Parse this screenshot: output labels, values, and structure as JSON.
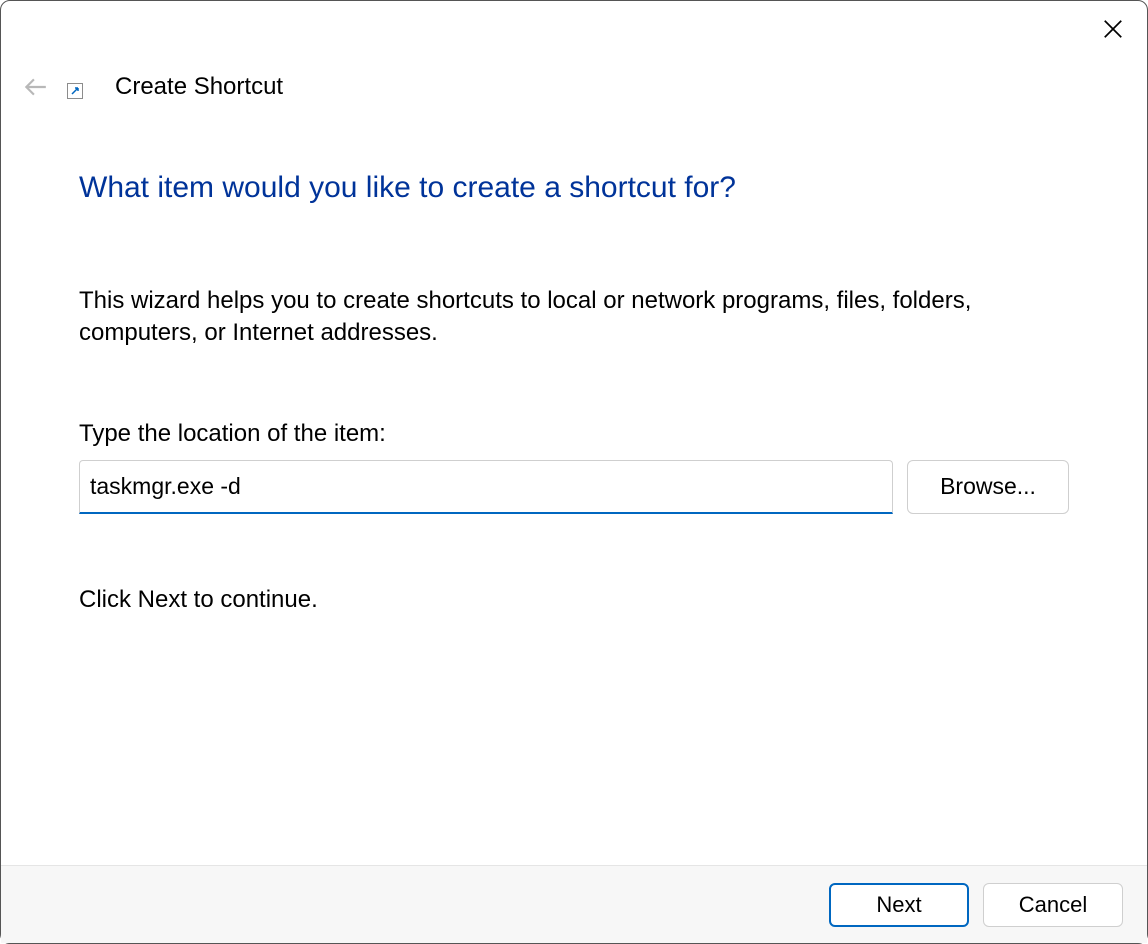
{
  "window": {
    "title": "Create Shortcut"
  },
  "wizard": {
    "heading": "What item would you like to create a shortcut for?",
    "description": "This wizard helps you to create shortcuts to local or network programs, files, folders, computers, or Internet addresses.",
    "field_label": "Type the location of the item:",
    "location_value": "taskmgr.exe -d",
    "browse_label": "Browse...",
    "hint": "Click Next to continue."
  },
  "footer": {
    "next_label": "Next",
    "cancel_label": "Cancel"
  }
}
